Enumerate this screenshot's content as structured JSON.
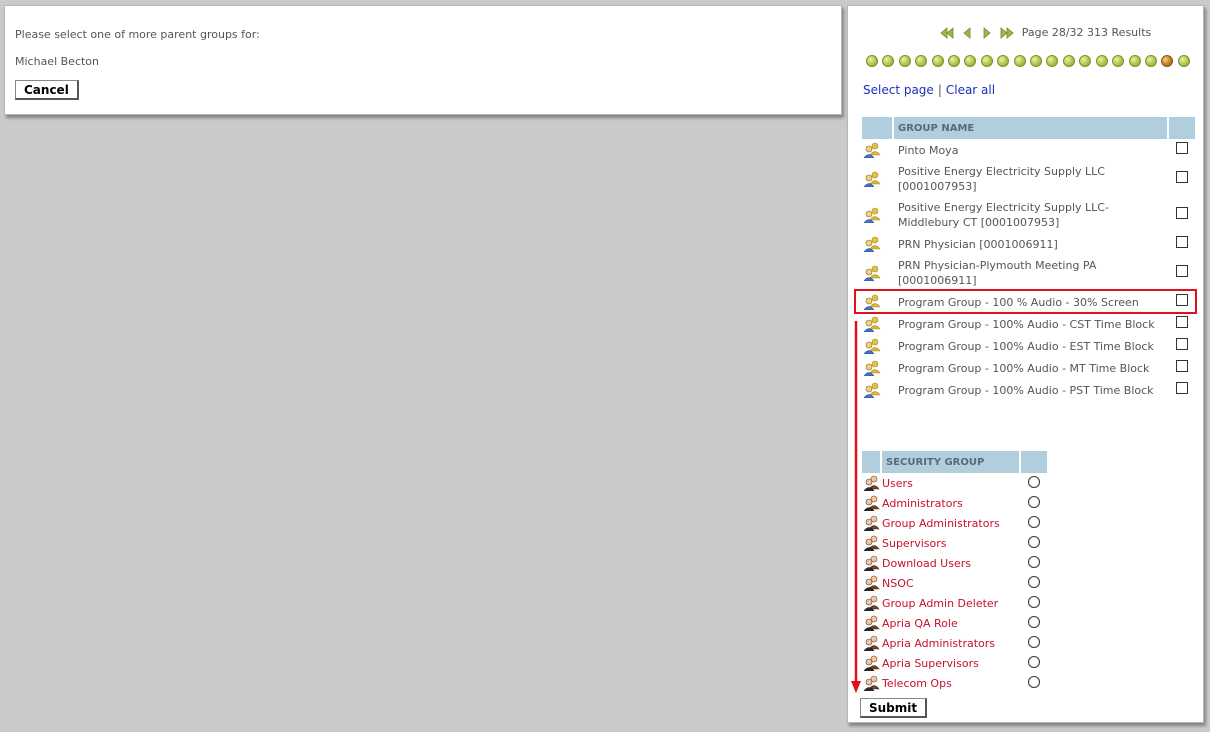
{
  "left": {
    "prompt": "Please select one of more parent groups for:",
    "user_name": "Michael Becton",
    "cancel_label": "Cancel"
  },
  "pager": {
    "info": "Page 28/32 313 Results",
    "page_count": 20,
    "current_dot_index": 18
  },
  "links": {
    "select_page": "Select page",
    "separator": "|",
    "clear_all": "Clear all"
  },
  "group_table": {
    "header": "GROUP NAME",
    "rows": [
      {
        "name": "Pinto Moya"
      },
      {
        "name": "Positive Energy Electricity Supply LLC [0001007953]"
      },
      {
        "name": "Positive Energy Electricity Supply LLC-Middlebury CT [0001007953]"
      },
      {
        "name": "PRN Physician [0001006911]"
      },
      {
        "name": "PRN Physician-Plymouth Meeting PA [0001006911]"
      },
      {
        "name": "Program Group - 100 % Audio - 30% Screen"
      },
      {
        "name": "Program Group - 100% Audio - CST Time Block"
      },
      {
        "name": "Program Group - 100% Audio - EST Time Block"
      },
      {
        "name": "Program Group - 100% Audio - MT Time Block"
      },
      {
        "name": "Program Group - 100% Audio - PST Time Block"
      }
    ]
  },
  "security_table": {
    "header": "SECURITY GROUP",
    "rows": [
      {
        "name": "Users"
      },
      {
        "name": "Administrators"
      },
      {
        "name": "Group Administrators"
      },
      {
        "name": "Supervisors"
      },
      {
        "name": "Download Users"
      },
      {
        "name": "NSOC"
      },
      {
        "name": "Group Admin Deleter"
      },
      {
        "name": "Apria QA Role"
      },
      {
        "name": "Apria Administrators"
      },
      {
        "name": "Apria Supervisors"
      },
      {
        "name": "Telecom Ops"
      }
    ]
  },
  "submit_label": "Submit",
  "colors": {
    "annotation": "#e0111b",
    "link_blue": "#1a2fb8",
    "security_red": "#c8102e",
    "header_bg": "#b0cedd"
  },
  "icons": {
    "group_row": "group-people-icon",
    "security_row": "security-person-icon",
    "pager": [
      "first-page-icon",
      "prev-page-icon",
      "next-page-icon",
      "last-page-icon"
    ]
  }
}
